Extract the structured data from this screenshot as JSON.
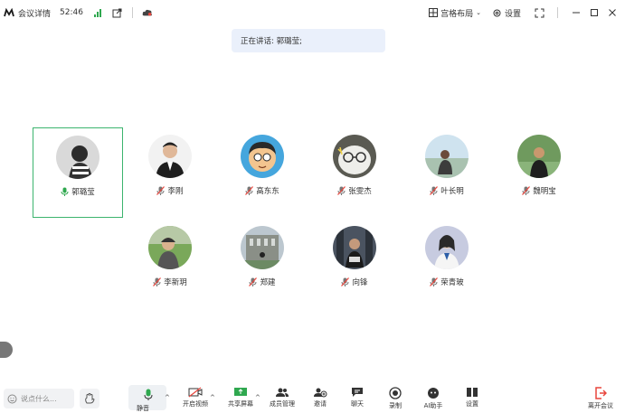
{
  "topbar": {
    "meeting_details_label": "会议详情",
    "timer": "52:46",
    "layout_label": "宫格布局",
    "settings_label": "设置"
  },
  "speaking": {
    "text": "正在讲话: 郭璐莹;"
  },
  "participants": [
    {
      "name": "郭璐莹",
      "muted": false,
      "active": true
    },
    {
      "name": "李刚",
      "muted": true,
      "active": false
    },
    {
      "name": "高东东",
      "muted": true,
      "active": false
    },
    {
      "name": "张雯杰",
      "muted": true,
      "active": false
    },
    {
      "name": "叶长明",
      "muted": true,
      "active": false
    },
    {
      "name": "魏明宝",
      "muted": true,
      "active": false
    },
    {
      "name": "李新玥",
      "muted": true,
      "active": false
    },
    {
      "name": "郑建",
      "muted": true,
      "active": false
    },
    {
      "name": "向锋",
      "muted": true,
      "active": false
    },
    {
      "name": "荣青玻",
      "muted": true,
      "active": false
    }
  ],
  "bottombar": {
    "chat_placeholder": "说点什么...",
    "mic_label": "静音",
    "video_label": "开启视频",
    "share_label": "共享屏幕",
    "members_label": "成员管理",
    "invite_label": "邀请",
    "chat_label": "聊天",
    "record_label": "录制",
    "apps_label": "AI助手",
    "more_label": "设置",
    "leave_label": "离开会议"
  },
  "colors": {
    "accent": "#2fa84f",
    "active_border": "#3cb46e",
    "leave": "#e8453c",
    "speaker_bg": "#eaf0fb"
  }
}
